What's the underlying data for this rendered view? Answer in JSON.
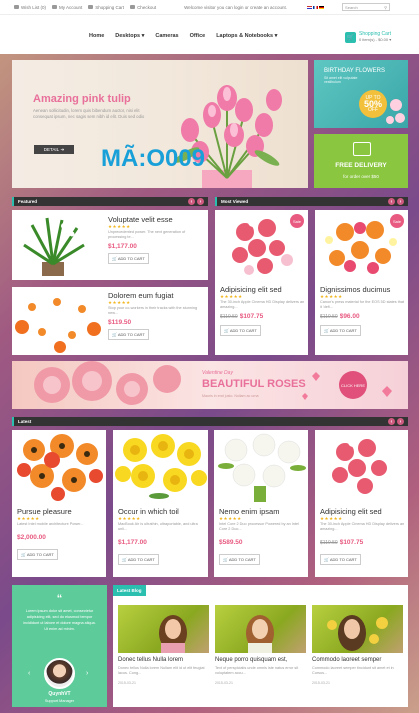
{
  "topbar": {
    "wishlist": "Wish List (0)",
    "account": "My Account",
    "shopping_cart": "Shopping Cart",
    "checkout": "Checkout",
    "welcome": "Welcome visitor you can login or create an account.",
    "search_placeholder": "Search"
  },
  "nav": {
    "items": [
      "Home",
      "Desktops",
      "Cameras",
      "Office",
      "Laptops & Notebooks"
    ]
  },
  "cart": {
    "title": "Shopping Cart",
    "subtitle": "0 item(s) - $0.00"
  },
  "slider": {
    "title": "Amazing pink tulip",
    "text": "Aenean sollicitudin, lorem quis bibendum auctor, nisi elit consequat ipsum, nec sagis sem nibh id elit. Duis sed odio",
    "button": "DETAIL",
    "watermark": "MÃ:O009"
  },
  "banner1": {
    "title": "BIRTHDAY FLOWERS",
    "sub": "Sit amet elit vulputate vestibulum",
    "badge_prefix": "UP TO",
    "badge_value": "50%",
    "badge_suffix": "OFF"
  },
  "banner2": {
    "title": "FREE DELIVERY",
    "sub": "for order over $50"
  },
  "featured": {
    "title": "Featured",
    "items": [
      {
        "name": "Voluptate velit esse",
        "desc": "Unprecedented power. The next generation of processing te...",
        "price": "$1,177.00",
        "button": "ADD TO CART"
      },
      {
        "name": "Dolorem eum fugiat",
        "desc": "Stop your co-workers in their tracks with the stunning new...",
        "price": "$119.50",
        "button": "ADD TO CART"
      }
    ]
  },
  "most_viewed": {
    "title": "Most Viewed",
    "items": [
      {
        "name": "Adipisicing elit sed",
        "desc": "The 30-inch Apple Cinema HD Display delivers an amazing...",
        "old": "$119.50",
        "price": "$107.75",
        "button": "ADD TO CART",
        "sale": "Sale"
      },
      {
        "name": "Dignissimos ducimus",
        "desc": "Canon's press material for the EOS 5D states that it 'defi...",
        "old": "$119.50",
        "price": "$96.00",
        "button": "ADD TO CART",
        "sale": "Sale"
      }
    ]
  },
  "promo": {
    "valentine": "Valentine Day",
    "title": "BEAUTIFUL ROSES",
    "sub": "Mauris in erat justo. Nullam ac urna",
    "button": "CLICK HERE"
  },
  "latest": {
    "title": "Latest",
    "items": [
      {
        "name": "Pursue pleasure",
        "desc": "Latest Intel mobile architecture Power...",
        "price": "$2,000.00",
        "old": "",
        "button": "ADD TO CART"
      },
      {
        "name": "Occur in which toil",
        "desc": "MacBook Air is ultrathin, ultraportable, and ultra unli...",
        "price": "$1,177.00",
        "old": "",
        "button": "ADD TO CART"
      },
      {
        "name": "Nemo enim ipsam",
        "desc": "Intel Core 2 Duo processor Powered by an Intel Core 2 Duo...",
        "price": "$589.50",
        "old": "",
        "button": "ADD TO CART"
      },
      {
        "name": "Adipisicing elit sed",
        "desc": "The 30-inch Apple Cinema HD Display delivers an amazing...",
        "price": "$107.75",
        "old": "$119.50",
        "button": "ADD TO CART"
      }
    ]
  },
  "testimonial": {
    "quote": "“",
    "text": "Lorem ipsum dolor sit amet, consectetur adipisicing elit, sed do eiusmod tempor incididunt ut labore et dolore magna aliqua. Ut enim ad minim.",
    "name": "QuynhVT",
    "role": "Support Manager"
  },
  "blog": {
    "title": "Latest Blog",
    "posts": [
      {
        "title": "Donec tellus Nulla lorem",
        "desc": "Donec tellus Nulla lorem Nullam elit id ut elit feugiat lacus. Cong...",
        "date": "2015-03-21"
      },
      {
        "title": "Neque porro quisquam est,",
        "desc": "Text of perspiciatis unde omnis iste natus error sit voluptatem accu...",
        "date": "2015-03-21"
      },
      {
        "title": "Commodo laoreet semper",
        "desc": "Commodo laoreet semper tincidunt sit amet et in Cursus...",
        "date": "2015-03-21"
      }
    ]
  },
  "colors": {
    "accent": "#2bbfb0",
    "pink": "#e85a80",
    "star": "#f2b61d",
    "green": "#8ac640"
  }
}
